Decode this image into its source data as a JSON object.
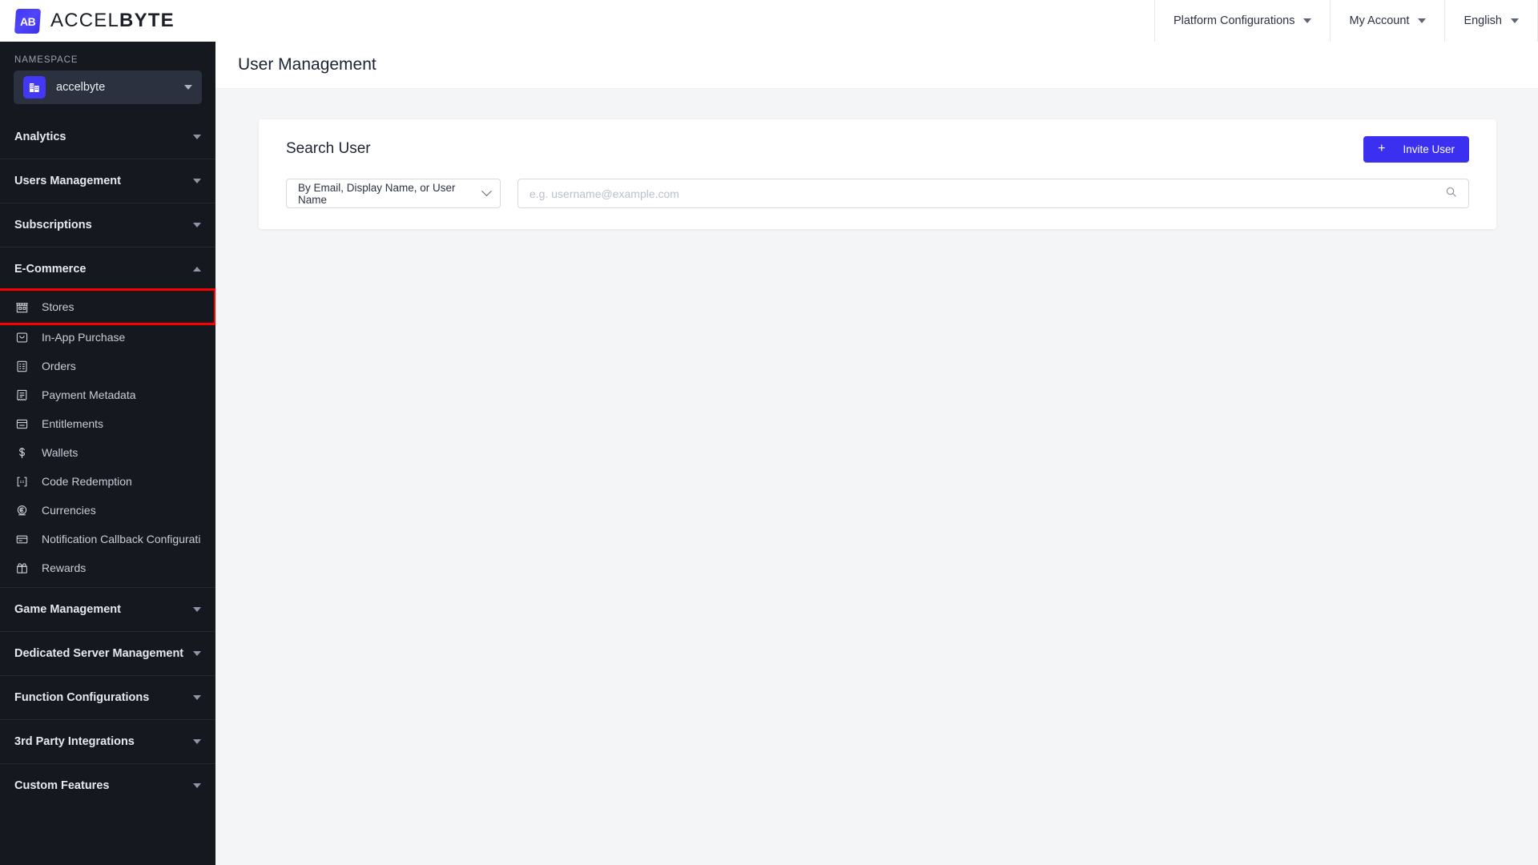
{
  "brand": {
    "logo_icon": "accelbyte-logo-icon",
    "logo_mark": "AB",
    "name_light": "ACCEL",
    "name_bold": "BYTE"
  },
  "topnav": {
    "items": [
      {
        "label": "Platform Configurations",
        "icon": "chevron-down-icon"
      },
      {
        "label": "My Account",
        "icon": "chevron-down-icon"
      },
      {
        "label": "English",
        "icon": "chevron-down-icon"
      }
    ]
  },
  "sidebar": {
    "namespace_label": "NAMESPACE",
    "namespace_value": "accelbyte",
    "namespace_icon": "building-icon",
    "namespace_caret": "chevron-down-icon",
    "sections_top": [
      {
        "label": "Analytics",
        "state": "collapsed",
        "icon": "chevron-down-icon"
      },
      {
        "label": "Users Management",
        "state": "collapsed",
        "icon": "chevron-down-icon"
      },
      {
        "label": "Subscriptions",
        "state": "collapsed",
        "icon": "chevron-down-icon"
      },
      {
        "label": "E-Commerce",
        "state": "expanded",
        "icon": "chevron-up-icon"
      }
    ],
    "ecommerce_items": [
      {
        "label": "Stores",
        "icon": "store-icon",
        "highlighted": true
      },
      {
        "label": "In-App Purchase",
        "icon": "bag-icon",
        "highlighted": false
      },
      {
        "label": "Orders",
        "icon": "receipt-list-icon",
        "highlighted": false
      },
      {
        "label": "Payment Metadata",
        "icon": "invoice-icon",
        "highlighted": false
      },
      {
        "label": "Entitlements",
        "icon": "card-minus-icon",
        "highlighted": false
      },
      {
        "label": "Wallets",
        "icon": "dollar-icon",
        "highlighted": false
      },
      {
        "label": "Code Redemption",
        "icon": "code-brackets-icon",
        "highlighted": false
      },
      {
        "label": "Currencies",
        "icon": "currency-euro-icon",
        "highlighted": false
      },
      {
        "label": "Notification Callback Configurati",
        "icon": "card-swipe-icon",
        "highlighted": false
      },
      {
        "label": "Rewards",
        "icon": "gift-icon",
        "highlighted": false
      }
    ],
    "sections_bottom": [
      {
        "label": "Game Management",
        "state": "collapsed",
        "icon": "chevron-down-icon"
      },
      {
        "label": "Dedicated Server Management",
        "state": "collapsed",
        "icon": "chevron-down-icon"
      },
      {
        "label": "Function Configurations",
        "state": "collapsed",
        "icon": "chevron-down-icon"
      },
      {
        "label": "3rd Party Integrations",
        "state": "collapsed",
        "icon": "chevron-down-icon"
      },
      {
        "label": "Custom Features",
        "state": "collapsed",
        "icon": "chevron-down-icon"
      }
    ]
  },
  "page": {
    "title": "User Management"
  },
  "search_card": {
    "title": "Search User",
    "invite_button_label": "Invite User",
    "invite_button_icon": "plus-icon",
    "filter_selected": "By Email, Display Name, or User Name",
    "filter_caret_icon": "chevron-down-icon",
    "search_value": "",
    "search_placeholder": "e.g. username@example.com",
    "search_icon": "search-icon"
  },
  "colors": {
    "accent": "#3b30f0",
    "sidebar_bg": "#16181f",
    "namespace_bg": "#2c3140",
    "content_bg": "#f4f5f7",
    "highlight_box": "#ff0000"
  }
}
